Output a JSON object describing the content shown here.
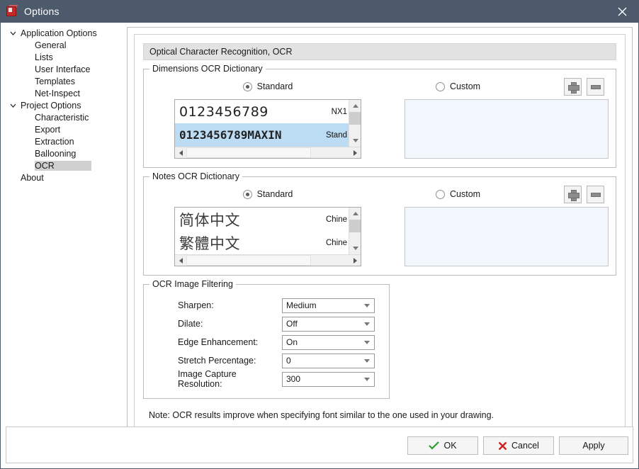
{
  "window": {
    "title": "Options",
    "app_icon": "red-cube-icon",
    "close_icon": "close-icon"
  },
  "sidebar": {
    "items": [
      {
        "label": "Application Options",
        "level": "root",
        "expanded": true,
        "selected": false
      },
      {
        "label": "General",
        "level": "child",
        "selected": false
      },
      {
        "label": "Lists",
        "level": "child",
        "selected": false
      },
      {
        "label": "User Interface",
        "level": "child",
        "selected": false
      },
      {
        "label": "Templates",
        "level": "child",
        "selected": false
      },
      {
        "label": "Net-Inspect",
        "level": "child",
        "selected": false
      },
      {
        "label": "Project Options",
        "level": "root",
        "expanded": true,
        "selected": false
      },
      {
        "label": "Characteristic",
        "level": "child",
        "selected": false
      },
      {
        "label": "Export",
        "level": "child",
        "selected": false
      },
      {
        "label": "Extraction",
        "level": "child",
        "selected": false
      },
      {
        "label": "Ballooning",
        "level": "child",
        "selected": false
      },
      {
        "label": "OCR",
        "level": "child",
        "selected": true
      },
      {
        "label": "About",
        "level": "leafroot",
        "selected": false
      }
    ]
  },
  "main": {
    "section_title": "Optical Character Recognition, OCR",
    "dimensions_group": {
      "title": "Dimensions OCR Dictionary",
      "standard_label": "Standard",
      "standard_selected": true,
      "custom_label": "Custom",
      "custom_selected": false,
      "add_button_icon": "plus-icon",
      "remove_button_icon": "minus-icon",
      "list_items": [
        {
          "sample": "0123456789",
          "name": "NX1",
          "selected": false
        },
        {
          "sample": "0123456789MAXIN",
          "name": "Stand",
          "selected": true
        }
      ],
      "custom_list_items": []
    },
    "notes_group": {
      "title": "Notes OCR Dictionary",
      "standard_label": "Standard",
      "standard_selected": true,
      "custom_label": "Custom",
      "custom_selected": false,
      "add_button_icon": "plus-icon",
      "remove_button_icon": "minus-icon",
      "list_items": [
        {
          "sample": "简体中文",
          "name": "Chine",
          "selected": false
        },
        {
          "sample": "繁體中文",
          "name": "Chine",
          "selected": false
        }
      ],
      "custom_list_items": []
    },
    "filtering_group": {
      "title": "OCR Image Filtering",
      "fields": [
        {
          "label": "Sharpen:",
          "value": "Medium"
        },
        {
          "label": "Dilate:",
          "value": "Off"
        },
        {
          "label": "Edge Enhancement:",
          "value": "On"
        },
        {
          "label": "Stretch Percentage:",
          "value": "0"
        },
        {
          "label": "Image Capture Resolution:",
          "value": "300"
        }
      ]
    },
    "note": "Note: OCR results improve when specifying font similar to the one used in your drawing."
  },
  "footer": {
    "ok_label": "OK",
    "cancel_label": "Cancel",
    "apply_label": "Apply",
    "ok_icon": "check-icon",
    "cancel_icon": "x-icon"
  },
  "colors": {
    "titlebar": "#4d5a6b",
    "selection": "#bcdcf4",
    "tree_selection": "#d0d0d0",
    "custom_box": "#f2f6fd",
    "ok_check": "#2e9b2e",
    "cancel_x": "#cc2121"
  }
}
